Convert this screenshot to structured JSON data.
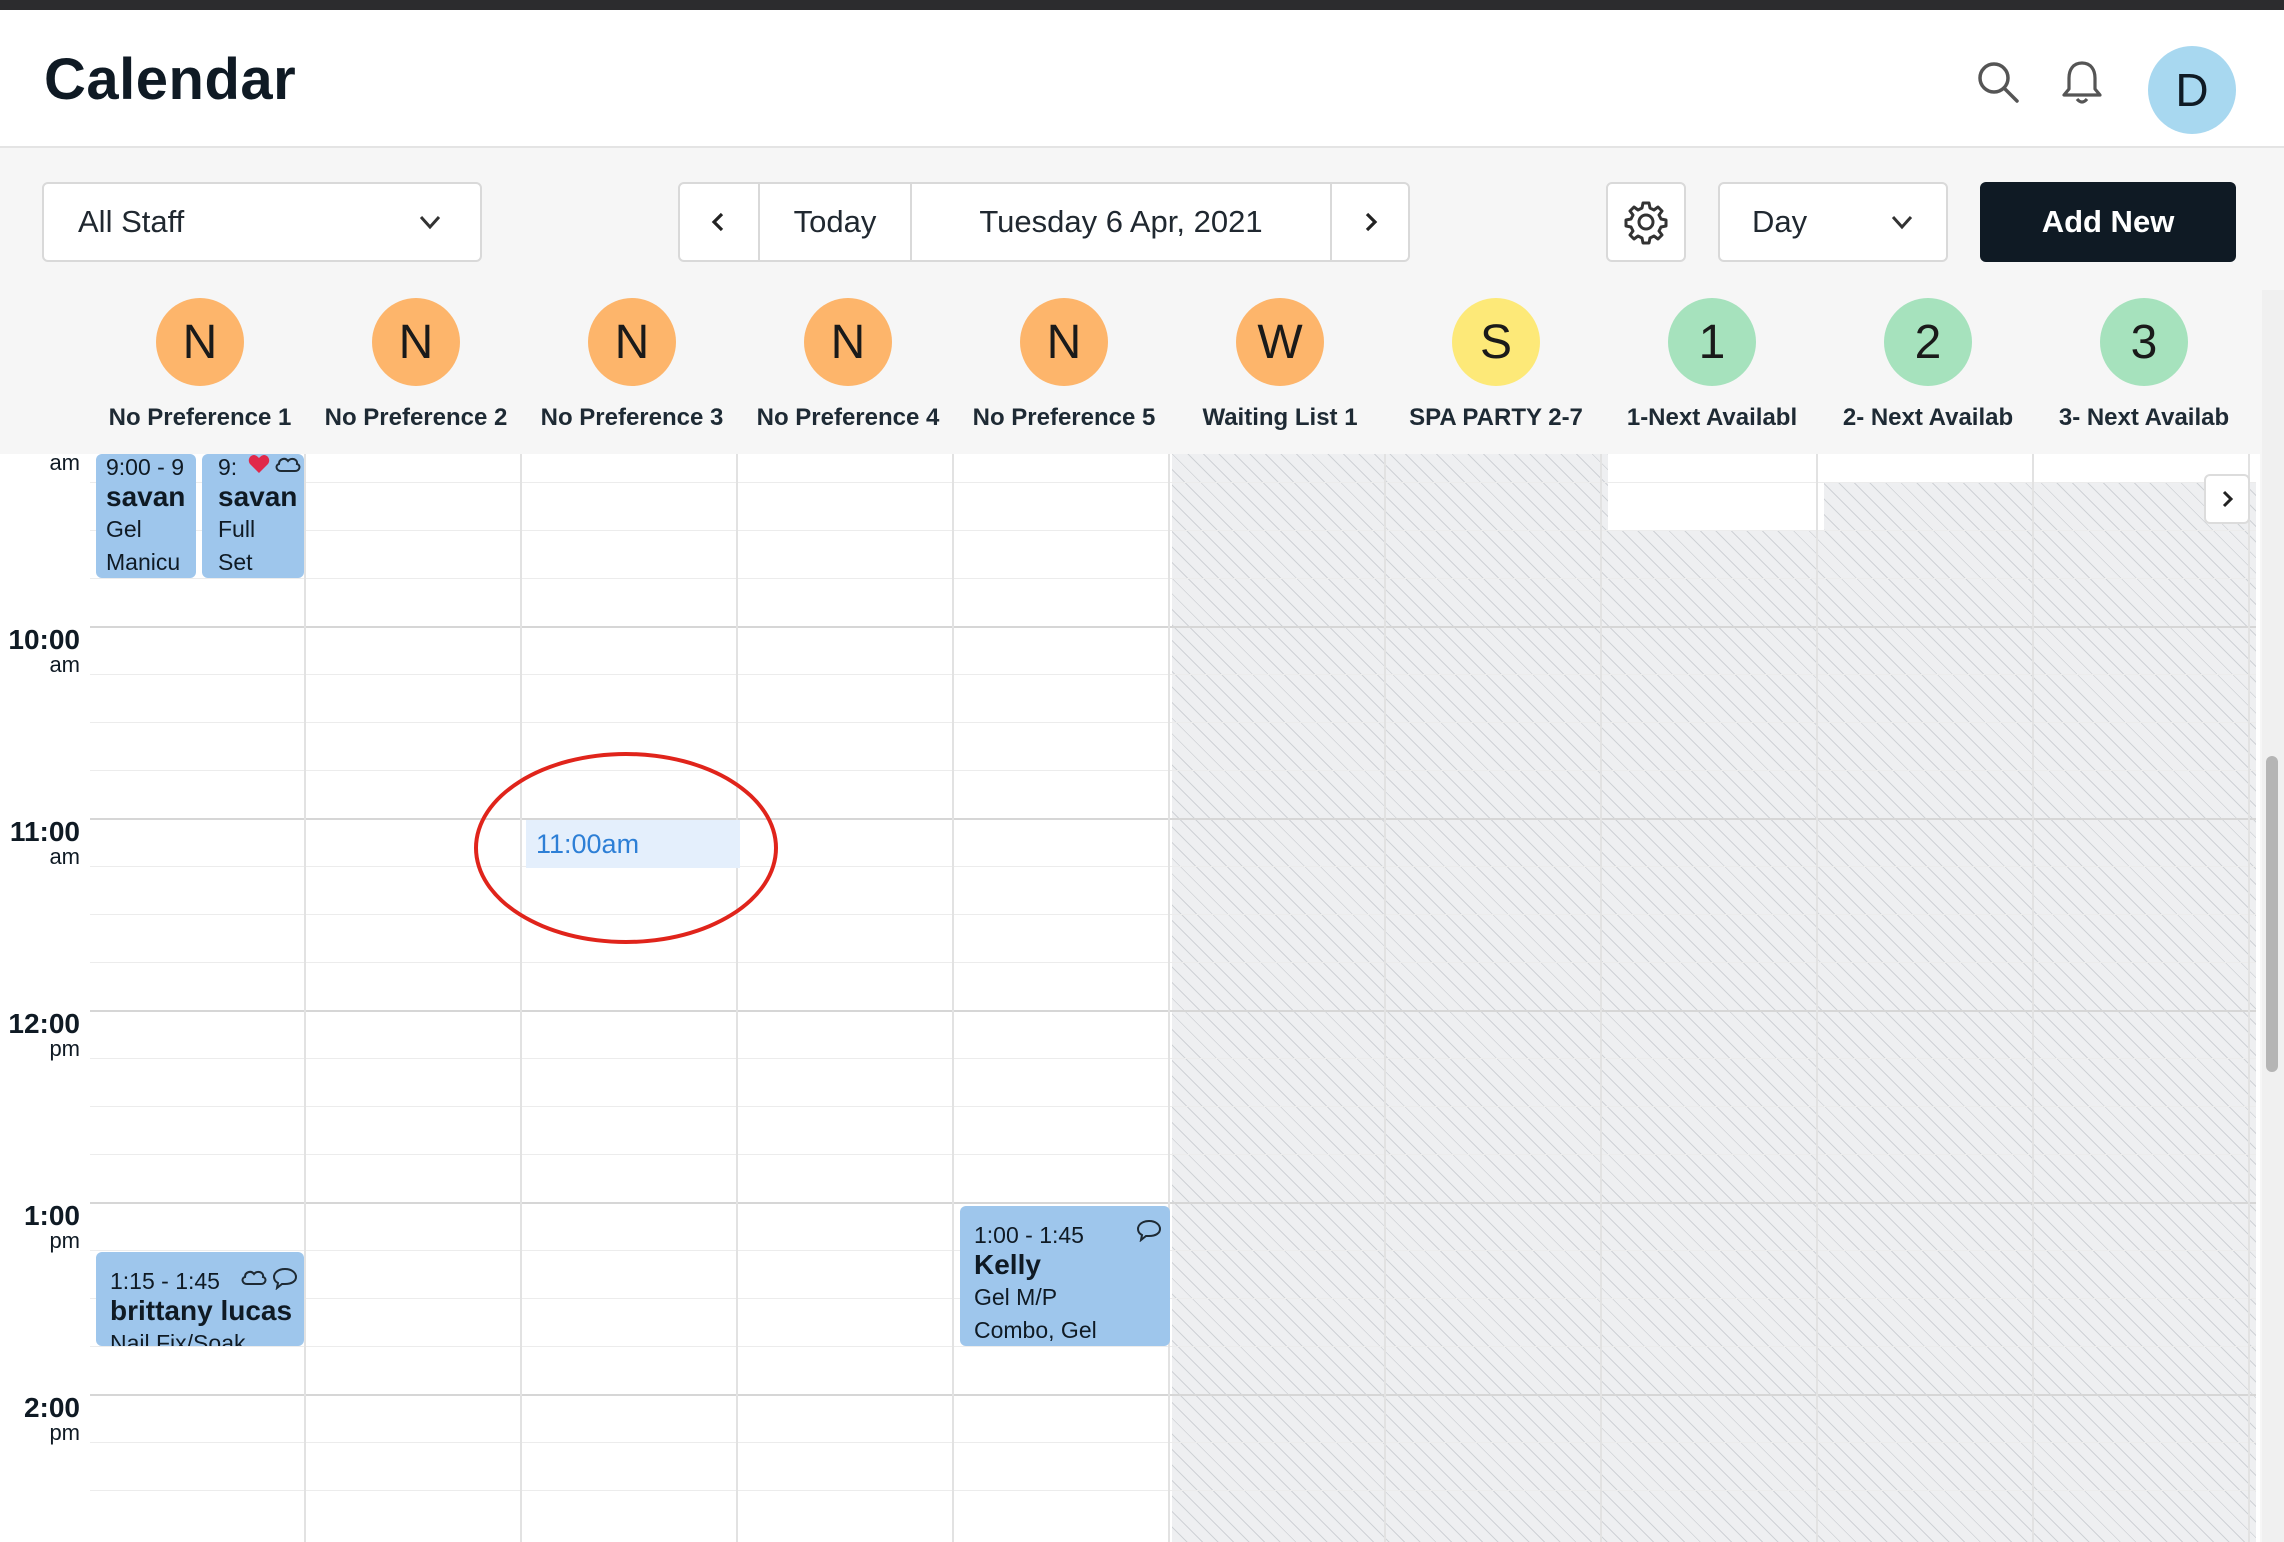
{
  "header": {
    "title": "Calendar",
    "avatar_initial": "D"
  },
  "toolbar": {
    "staff_filter": "All Staff",
    "prev_label": "‹",
    "today_label": "Today",
    "date_label": "Tuesday 6 Apr, 2021",
    "next_label": "›",
    "view_mode": "Day",
    "add_new_label": "Add New"
  },
  "staff": [
    {
      "initial": "N",
      "name": "No Preference 1",
      "color": "#fdb56b"
    },
    {
      "initial": "N",
      "name": "No Preference 2",
      "color": "#fdb56b"
    },
    {
      "initial": "N",
      "name": "No Preference 3",
      "color": "#fdb56b"
    },
    {
      "initial": "N",
      "name": "No Preference 4",
      "color": "#fdb56b"
    },
    {
      "initial": "N",
      "name": "No Preference 5",
      "color": "#fdb56b"
    },
    {
      "initial": "W",
      "name": "Waiting List 1",
      "color": "#fdb56b"
    },
    {
      "initial": "S",
      "name": "SPA PARTY 2-7",
      "color": "#fde978"
    },
    {
      "initial": "1",
      "name": "1-Next Availabl",
      "color": "#a6e2bd"
    },
    {
      "initial": "2",
      "name": "2- Next Availab",
      "color": "#a6e2bd"
    },
    {
      "initial": "3",
      "name": "3- Next Availab",
      "color": "#a6e2bd"
    }
  ],
  "times": [
    {
      "t": "10:00",
      "ap": "am"
    },
    {
      "t": "11:00",
      "ap": "am"
    },
    {
      "t": "12:00",
      "ap": "pm"
    },
    {
      "t": "1:00",
      "ap": "pm"
    },
    {
      "t": "2:00",
      "ap": "pm"
    }
  ],
  "partial_time": {
    "ap": "am"
  },
  "appointments": {
    "a1": {
      "time": "9:00 - 9",
      "name": "savan",
      "service_1": "Gel",
      "service_2": "Manicu"
    },
    "a2": {
      "time": "9:",
      "name": "savan",
      "service_1": "Full",
      "service_2": "Set"
    },
    "a3": {
      "time": "1:15 - 1:45",
      "name": "brittany lucas",
      "service_1": "Nail Fix/Soak"
    },
    "a4": {
      "time": "1:00 - 1:45",
      "name": "Kelly",
      "service_1": "Gel M/P",
      "service_2": "Combo, Gel"
    }
  },
  "hover_slot": "11:00am"
}
